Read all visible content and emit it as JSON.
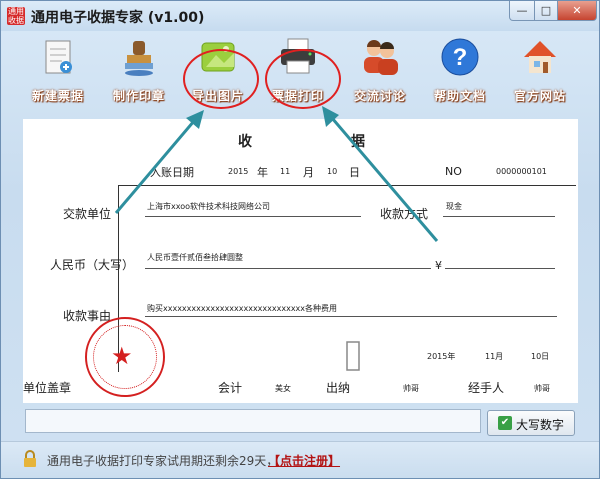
{
  "window": {
    "app_icon": "receipt-app-icon",
    "app_icon_text": "通用收据",
    "title": "通用电子收据专家 (v1.00)",
    "minimize": "—",
    "maximize": "□",
    "close": "✕"
  },
  "toolbar": {
    "items": [
      {
        "label": "新建票据",
        "icon": "new-receipt-icon"
      },
      {
        "label": "制作印章",
        "icon": "seal-stamp-icon"
      },
      {
        "label": "导出图片",
        "icon": "export-image-icon"
      },
      {
        "label": "票据打印",
        "icon": "printer-icon"
      },
      {
        "label": "交流讨论",
        "icon": "users-discussion-icon"
      },
      {
        "label": "帮助文档",
        "icon": "help-question-icon"
      },
      {
        "label": "官方网站",
        "icon": "home-website-icon"
      }
    ],
    "highlight_color": "#e02020"
  },
  "receipt": {
    "title_left": "收",
    "title_right": "据",
    "date_label": "入账日期",
    "year": "2015",
    "year_unit": "年",
    "month": "11",
    "month_unit": "月",
    "day": "10",
    "day_unit": "日",
    "no_label": "NO",
    "no_value": "0000000101",
    "payer_label": "交款单位",
    "payer_value": "上海市xxoo软件技术科技网络公司",
    "method_label": "收款方式",
    "method_value": "现金",
    "rmb_label": "人民币（大写）",
    "rmb_value": "人民币壹仟贰佰叁拾肆圆整",
    "yen_symbol": "¥",
    "reason_label": "收款事由",
    "reason_value": "购买xxxxxxxxxxxxxxxxxxxxxxxxxxxxxx各种费用",
    "sign_year": "2015年",
    "sign_month": "11月",
    "sign_day": "10日",
    "seal_label": "单位盖章",
    "accountant_label": "会计",
    "accountant_value": "美女",
    "cashier_label": "出纳",
    "cashier_value": "帅哥",
    "handler_label": "经手人",
    "handler_value": "帅哥",
    "stamp_color": "#d42020"
  },
  "bottom": {
    "input_value": "",
    "button_label": "大写数字",
    "button_icon": "green-check-icon"
  },
  "status": {
    "lock_icon": "lock-icon",
    "text": "通用电子收据打印专家试用期还剩余29天，",
    "register_link": "【点击注册】"
  }
}
